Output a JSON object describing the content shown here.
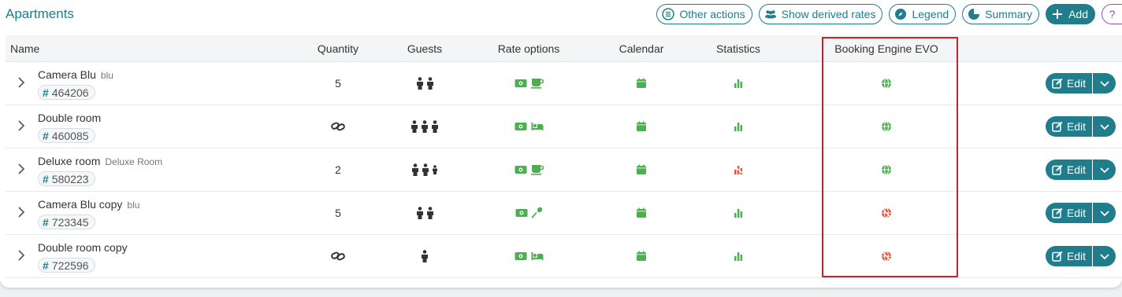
{
  "title": "Apartments",
  "toolbar": {
    "other_actions": "Other actions",
    "show_derived": "Show derived rates",
    "legend": "Legend",
    "summary": "Summary",
    "add": "Add",
    "help": "?"
  },
  "columns": [
    "Name",
    "Quantity",
    "Guests",
    "Rate options",
    "Calendar",
    "Statistics",
    "Booking Engine EVO"
  ],
  "rows": [
    {
      "name": "Camera Blu",
      "sub": "blu",
      "id": "464206",
      "qty": "5",
      "guests": "2 adults",
      "rate_icons": [
        "money-icon",
        "coffee-icon"
      ],
      "stat_status": "ok",
      "be_status": "ok",
      "edit": "Edit"
    },
    {
      "name": "Double room",
      "sub": "",
      "id": "460085",
      "qty": "",
      "guests": "3 adults",
      "rate_icons": [
        "money-icon",
        "bed-icon"
      ],
      "stat_status": "ok",
      "be_status": "ok",
      "edit": "Edit"
    },
    {
      "name": "Deluxe room",
      "sub": "Deluxe Room",
      "id": "580223",
      "qty": "2",
      "guests": "2 adults 1 child",
      "rate_icons": [
        "money-icon",
        "coffee-icon"
      ],
      "stat_status": "error",
      "be_status": "ok",
      "edit": "Edit"
    },
    {
      "name": "Camera Blu copy",
      "sub": "blu",
      "id": "723345",
      "qty": "5",
      "guests": "2 adults",
      "rate_icons": [
        "money-icon",
        "utensil-icon"
      ],
      "stat_status": "ok",
      "be_status": "error",
      "edit": "Edit"
    },
    {
      "name": "Double room copy",
      "sub": "",
      "id": "722596",
      "qty": "",
      "guests": "1 adult",
      "rate_icons": [
        "money-icon",
        "bed-icon"
      ],
      "stat_status": "ok",
      "be_status": "error",
      "edit": "Edit"
    }
  ],
  "colors": {
    "accent": "#1f7d8c",
    "ok": "#4caf50",
    "error": "#e5533d",
    "highlight": "#d0202a"
  }
}
